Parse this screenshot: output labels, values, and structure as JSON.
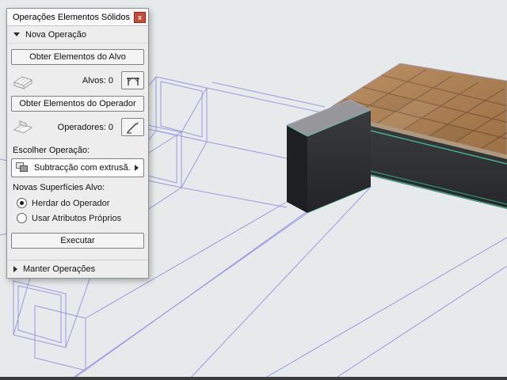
{
  "palette": {
    "title": "Operações Elementos Sólidos",
    "close_glyph": "x",
    "nova": {
      "header": "Nova Operação",
      "btn_target": "Obter Elementos do Alvo",
      "targets_count": "Alvos: 0",
      "btn_operator": "Obter Elementos do Operador",
      "operators_count": "Operadores: 0",
      "choose_label": "Escolher Operação:",
      "operation_value": "Subtracção com extrusã...",
      "surfaces_label": "Novas Superfícies Alvo:",
      "radio_inherit": "Herdar do Operador",
      "radio_inherit_selected": true,
      "radio_own": "Usar Atributos Próprios",
      "execute": "Executar"
    },
    "manter": {
      "header": "Manter Operações"
    }
  },
  "canvas": {
    "background": "#e7eaea",
    "wireframe_color": "#8f91e2",
    "highlight_green": "#3fc690",
    "tile_color": "#b2804e",
    "grout_color": "#7d5a37",
    "concrete_color": "#323336",
    "step_top_color": "#97969b"
  }
}
